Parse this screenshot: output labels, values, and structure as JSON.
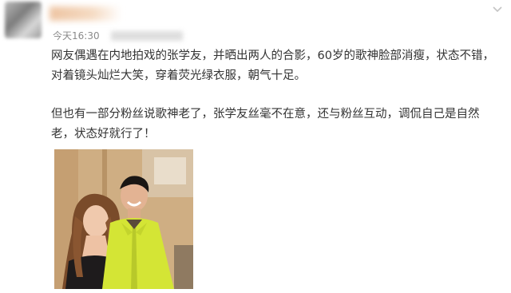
{
  "post": {
    "timestamp": "今天16:30",
    "paragraphs": [
      "网友偶遇在内地拍戏的张学友，并晒出两人的合影，60岁的歌神脸部消瘦，状态不错，对着镜头灿烂大笑，穿着荧光绿衣服，朝气十足。",
      "但也有一部分粉丝说歌神老了，张学友丝毫不在意，还与粉丝互动，调侃自己是自然老，状态好就行了！"
    ]
  },
  "icons": {
    "menu": "chevron-down-icon"
  },
  "colors": {
    "text": "#333333",
    "meta": "#8a8a8a",
    "jacket": "#d4e535"
  }
}
